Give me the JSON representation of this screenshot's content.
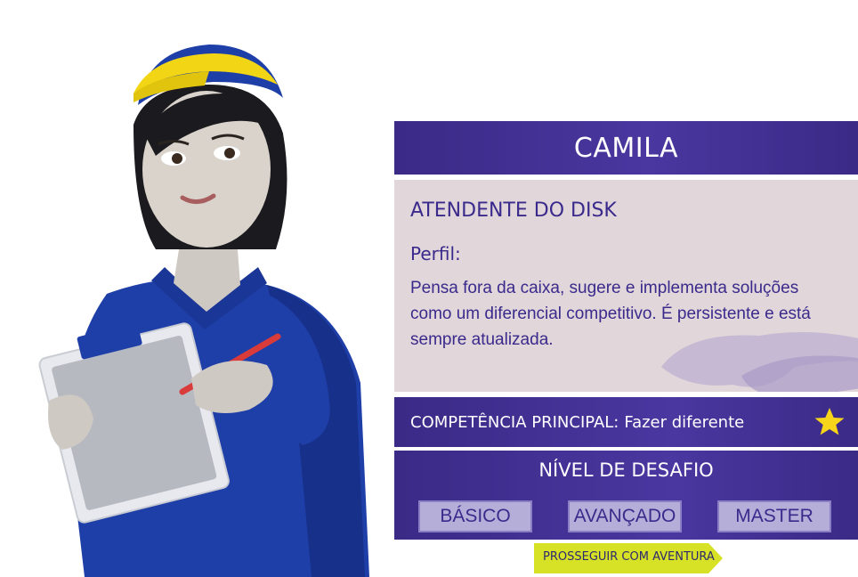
{
  "character": {
    "name": "CAMILA",
    "role": "ATENDENTE DO DISK",
    "profile_label": "Perfil:",
    "profile_text": "Pensa fora da caixa, sugere e implementa soluções como um diferencial competitivo. É persistente e está sempre atualizada.",
    "illustration_icon": "attendant-character-illustration"
  },
  "competence": {
    "label": "COMPETÊNCIA PRINCIPAL:",
    "value": "Fazer diferente",
    "icon": "star-icon"
  },
  "challenge": {
    "title": "NÍVEL DE DESAFIO",
    "levels": [
      {
        "label": "BÁSICO"
      },
      {
        "label": "AVANÇADO"
      },
      {
        "label": "MASTER"
      }
    ]
  },
  "continue": {
    "label": "PROSSEGUIR COM AVENTURA",
    "icon": "arrow-tag-shape"
  },
  "colors": {
    "panel_purple": "#3b2a86",
    "panel_text": "#ffffff",
    "profile_bg": "#e1d6da",
    "profile_text": "#3a2a8c",
    "button_bg": "#b5aed8",
    "continue_bg": "#d7e125",
    "star": "#f7d51a"
  }
}
